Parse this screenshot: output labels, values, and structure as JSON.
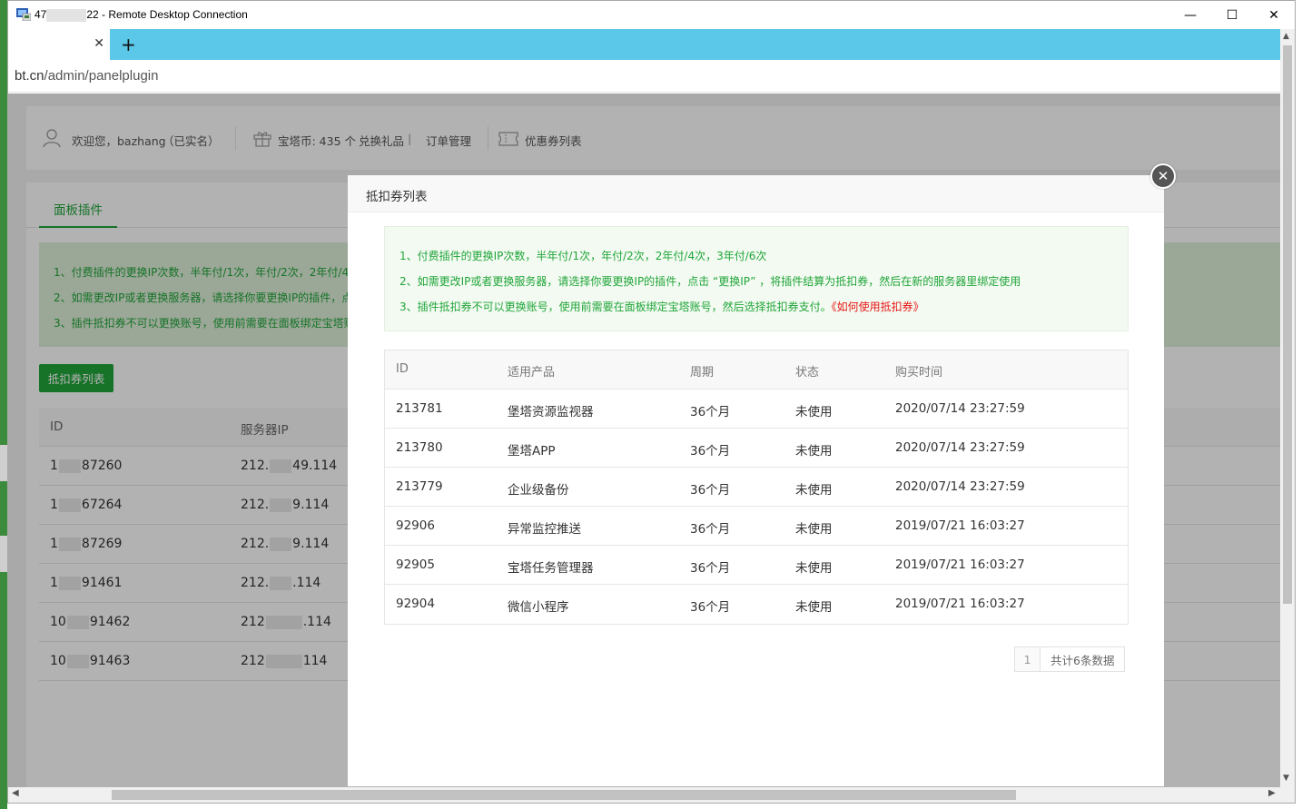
{
  "window": {
    "title_prefix": "47",
    "title_suffix": "22 - Remote Desktop Connection",
    "minimize": "—",
    "maximize": "☐",
    "close": "✕"
  },
  "browser": {
    "tab_close": "✕",
    "new_tab": "+",
    "url_host": "bt.cn",
    "url_path": "/admin/panelplugin"
  },
  "userbar": {
    "welcome": "欢迎您，bazhang",
    "verified": "（已实名）",
    "coins": "宝塔币: 435 个",
    "exchange": "兑换礼品",
    "separator": "|",
    "orders": "订单管理",
    "coupons": "优惠券列表"
  },
  "panel": {
    "tab": "面板插件",
    "notices": [
      "1、付费插件的更换IP次数，半年付/1次，年付/2次，2年付/4",
      "2、如需更改IP或者更换服务器，请选择你要更换IP的插件，点",
      "3、插件抵扣券不可以更换账号，使用前需要在面板绑定宝塔账"
    ],
    "button": "抵扣券列表",
    "table": {
      "headers": [
        "ID",
        "服务器IP"
      ],
      "rows": [
        {
          "id_a": "1",
          "id_b": "87260",
          "ip_a": "212.",
          "ip_b": "49.114"
        },
        {
          "id_a": "1",
          "id_b": "67264",
          "ip_a": "212.",
          "ip_b": "9.114"
        },
        {
          "id_a": "1",
          "id_b": "87269",
          "ip_a": "212.",
          "ip_b": "9.114"
        },
        {
          "id_a": "1",
          "id_b": "91461",
          "ip_a": "212.",
          "ip_b": ".114"
        },
        {
          "id_a": "10",
          "id_b": "91462",
          "ip_a": "212",
          "ip_b": ".114"
        },
        {
          "id_a": "10",
          "id_b": "91463",
          "ip_a": "212",
          "ip_b": "114"
        }
      ]
    }
  },
  "modal": {
    "title": "抵扣券列表",
    "close": "✕",
    "notices": {
      "line1": "1、付费插件的更换IP次数，半年付/1次，年付/2次，2年付/4次，3年付/6次",
      "line2": "2、如需更改IP或者更换服务器，请选择你要更换IP的插件，点击 “更换IP” ，将插件结算为抵扣券，然后在新的服务器里绑定使用",
      "line3": "3、插件抵扣券不可以更换账号，使用前需要在面板绑定宝塔账号，然后选择抵扣券支付。",
      "line3_link": "《如何使用抵扣券》"
    },
    "headers": {
      "id": "ID",
      "product": "适用产品",
      "cycle": "周期",
      "status": "状态",
      "time": "购买时间"
    },
    "rows": [
      {
        "id": "213781",
        "product": "堡塔资源监视器",
        "cycle": "36个月",
        "status": "未使用",
        "time": "2020/07/14 23:27:59"
      },
      {
        "id": "213780",
        "product": "堡塔APP",
        "cycle": "36个月",
        "status": "未使用",
        "time": "2020/07/14 23:27:59"
      },
      {
        "id": "213779",
        "product": "企业级备份",
        "cycle": "36个月",
        "status": "未使用",
        "time": "2020/07/14 23:27:59"
      },
      {
        "id": "92906",
        "product": "异常监控推送",
        "cycle": "36个月",
        "status": "未使用",
        "time": "2019/07/21 16:03:27"
      },
      {
        "id": "92905",
        "product": "宝塔任务管理器",
        "cycle": "36个月",
        "status": "未使用",
        "time": "2019/07/21 16:03:27"
      },
      {
        "id": "92904",
        "product": "微信小程序",
        "cycle": "36个月",
        "status": "未使用",
        "time": "2019/07/21 16:03:27"
      }
    ],
    "pager": {
      "page": "1",
      "total": "共计6条数据"
    }
  },
  "colors": {
    "accent": "#20a53a",
    "link_red": "#e81515",
    "tabstrip": "#5bc8e9"
  },
  "icons": [
    "rdp-app-icon",
    "user-icon",
    "gift-icon",
    "coupon-icon",
    "close-icon",
    "plus-icon",
    "chevron-up-icon",
    "chevron-down-icon",
    "chevron-left-icon",
    "chevron-right-icon"
  ]
}
